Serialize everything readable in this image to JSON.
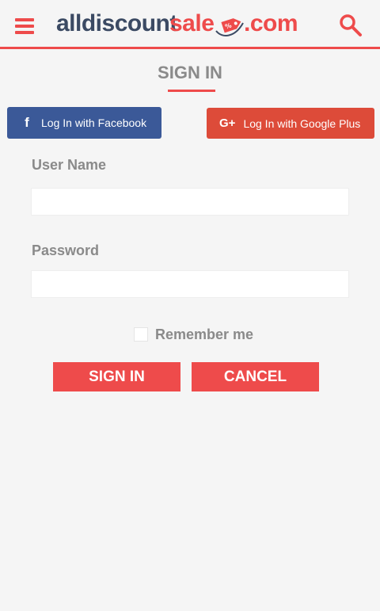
{
  "header": {
    "logo": {
      "part1": "alldiscount",
      "part2": "sale",
      "part3": ".com"
    },
    "menu_icon": "hamburger-icon",
    "search_icon": "search-icon"
  },
  "page": {
    "title": "SIGN IN"
  },
  "social": {
    "facebook_label": "Log In with Facebook",
    "facebook_icon": "f",
    "google_label": "Log In with Google Plus",
    "google_icon": "G+"
  },
  "form": {
    "username_label": "User Name",
    "username_value": "",
    "password_label": "Password",
    "password_value": "",
    "remember_label": "Remember me",
    "remember_checked": false
  },
  "actions": {
    "signin_label": "SIGN IN",
    "cancel_label": "CANCEL"
  },
  "colors": {
    "accent": "#ee4b4b",
    "facebook": "#3b5998",
    "google": "#dd4b39",
    "text_muted": "#8a8a8a",
    "logo_dark": "#3b4a63"
  }
}
